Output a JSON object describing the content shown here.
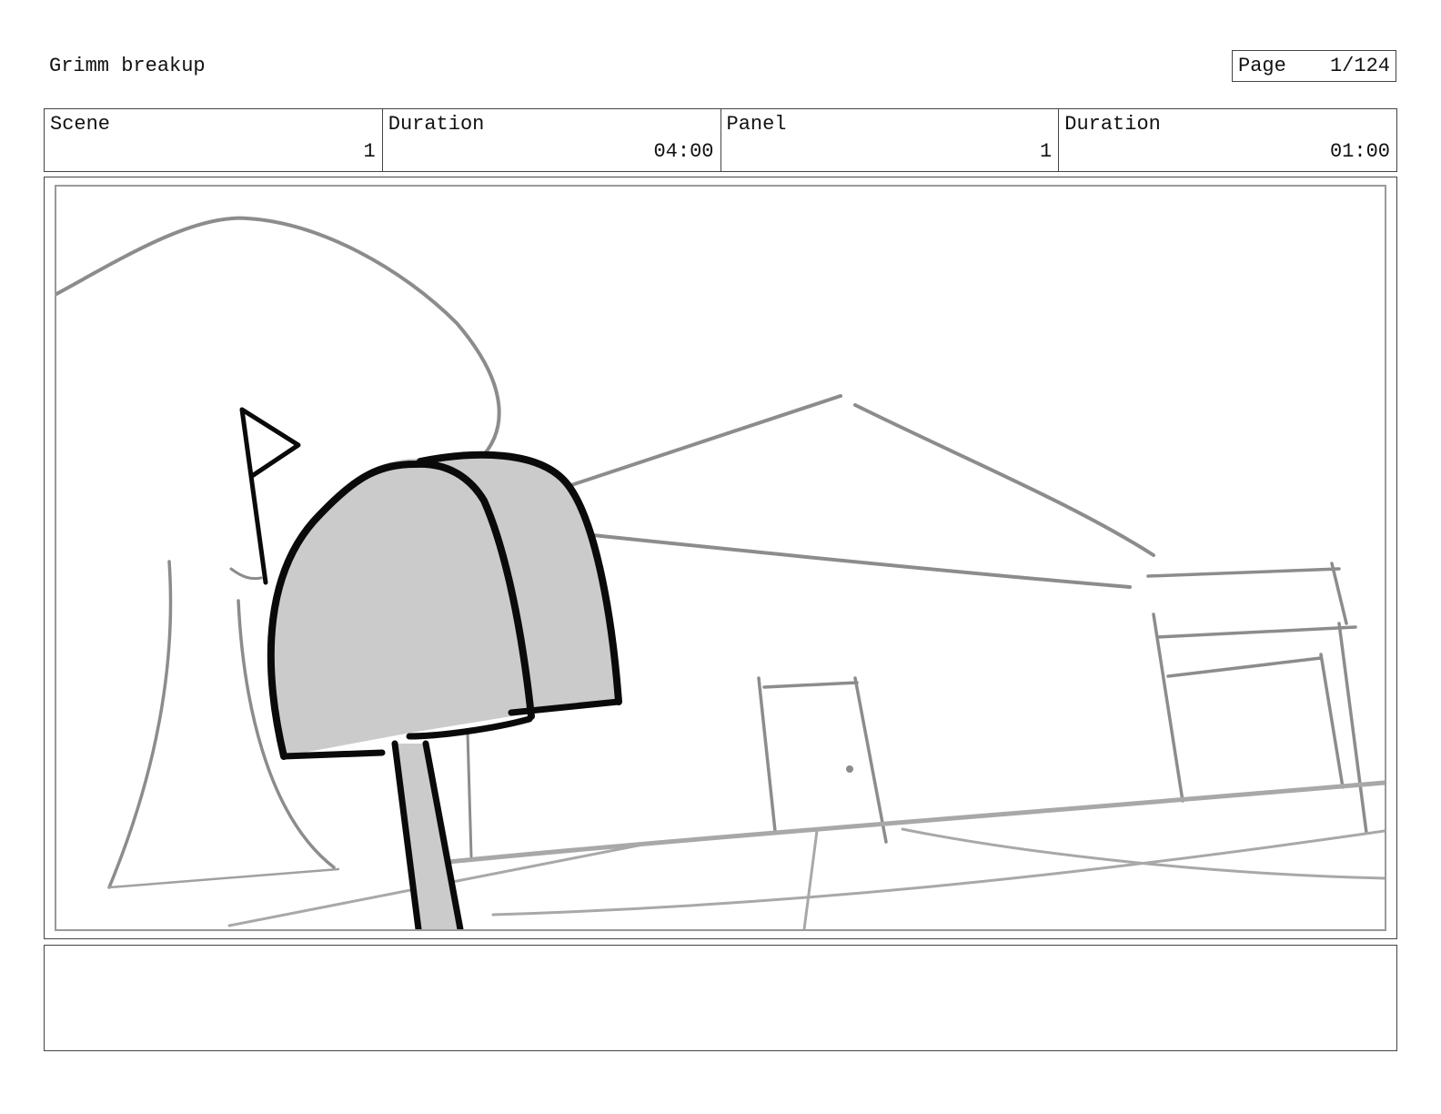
{
  "header": {
    "project_title": "Grimm breakup",
    "page_label": "Page",
    "page_value": "1/124"
  },
  "info": {
    "scene_label": "Scene",
    "scene_value": "1",
    "scene_duration_label": "Duration",
    "scene_duration_value": "04:00",
    "panel_label": "Panel",
    "panel_value": "1",
    "panel_duration_label": "Duration",
    "panel_duration_value": "01:00"
  },
  "notes": {
    "text": ""
  },
  "colors": {
    "sketch_line": "#8c8c8c",
    "ink": "#0a0a0a",
    "mailbox_fill": "#cbcbcb",
    "frame_border": "#9a9a9a"
  }
}
